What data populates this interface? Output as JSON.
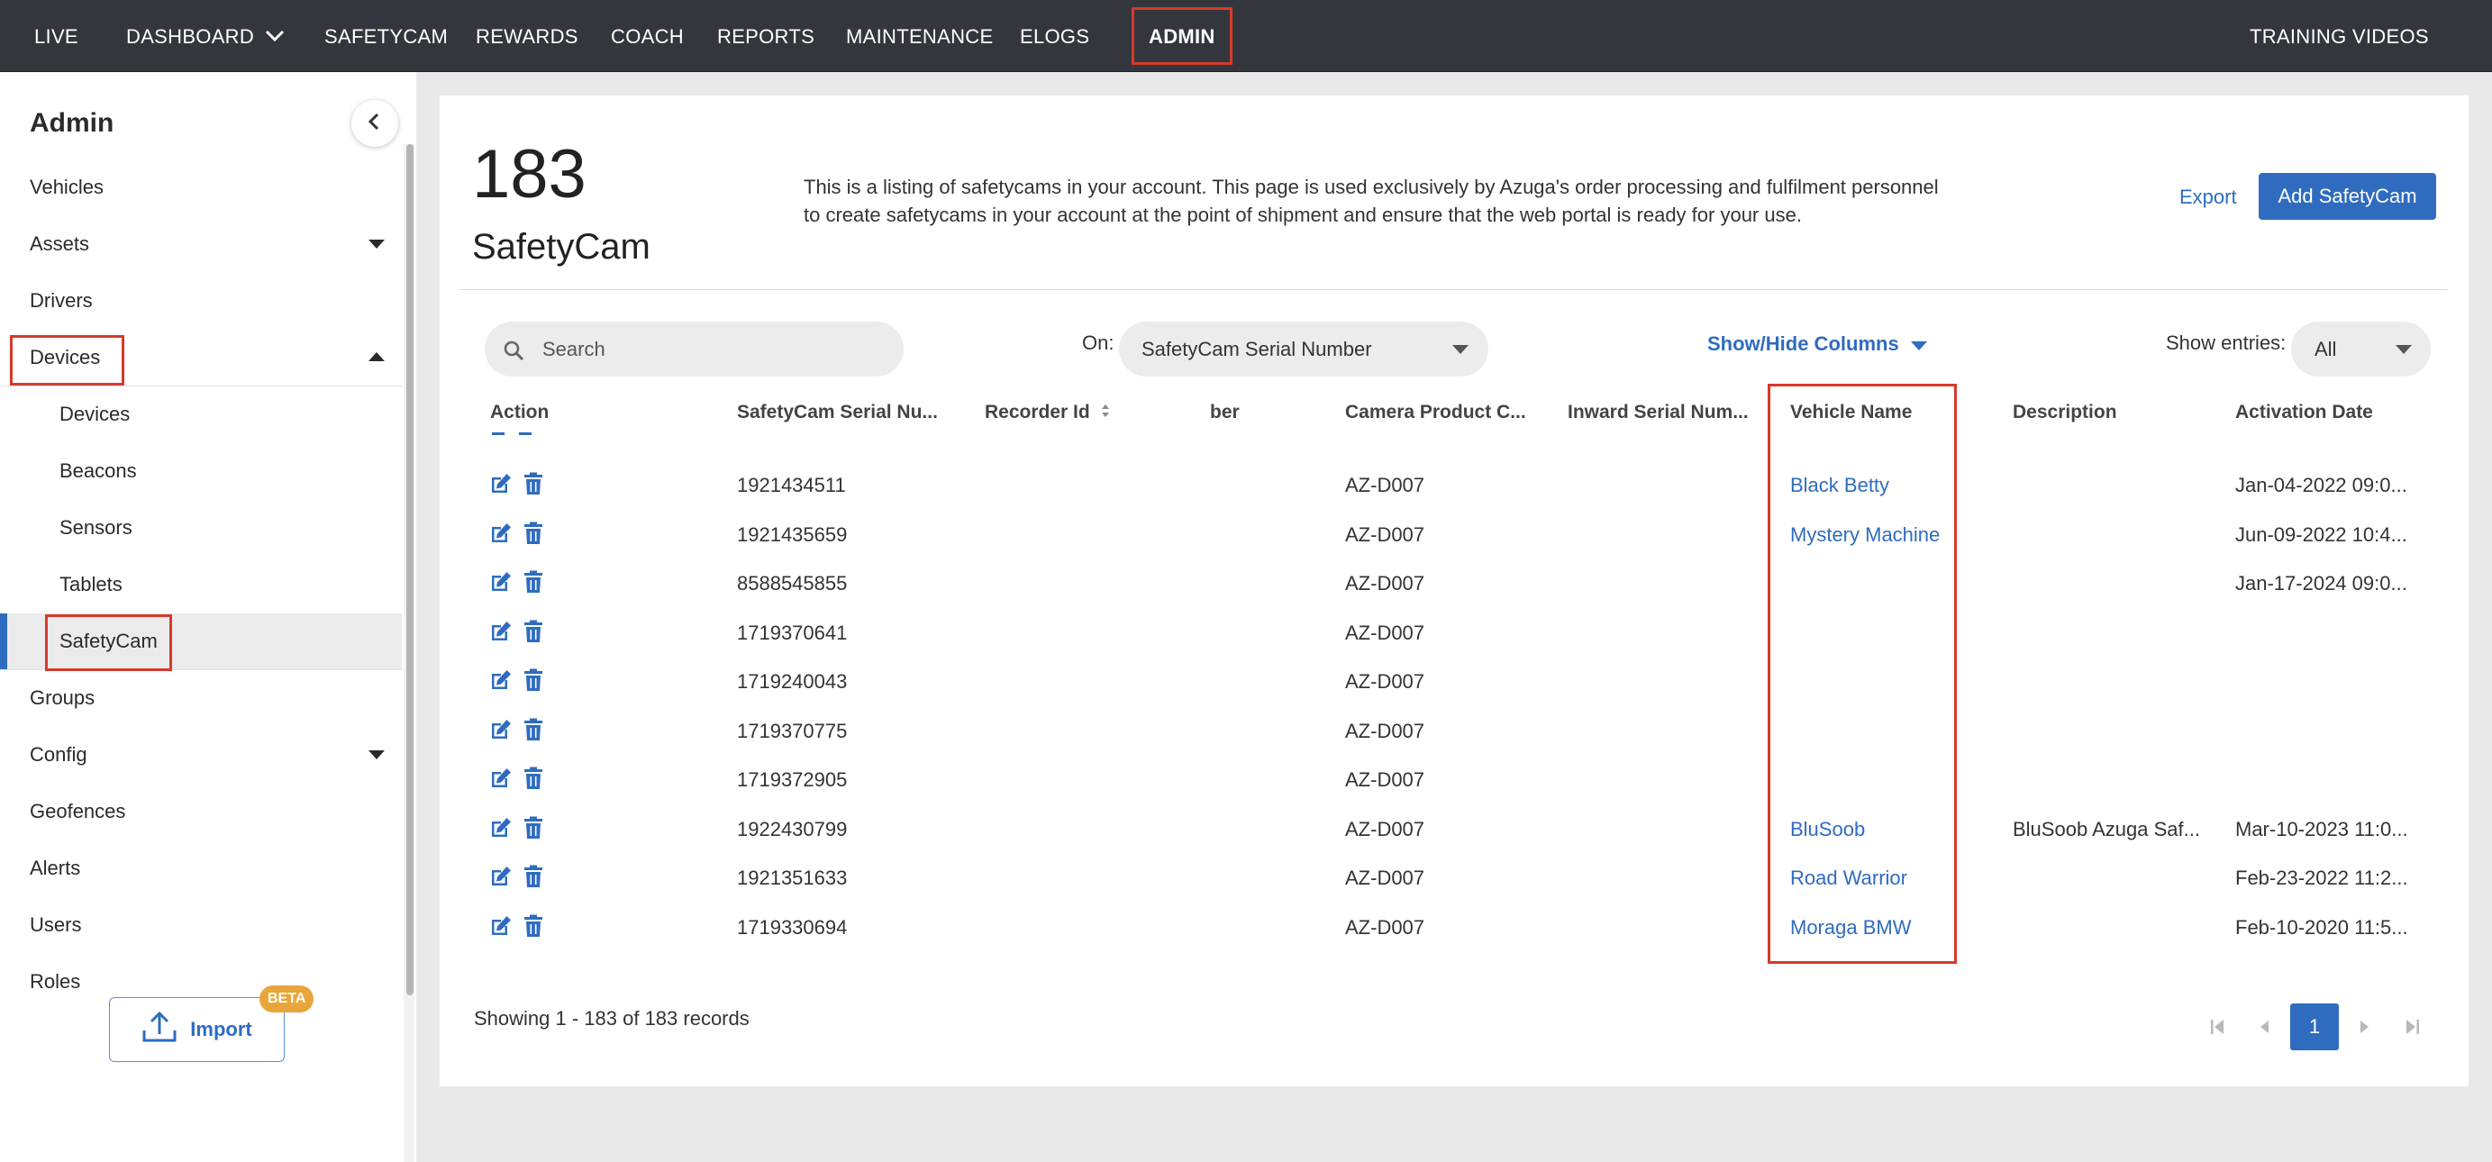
{
  "topnav": {
    "items": [
      {
        "label": "LIVE"
      },
      {
        "label": "DASHBOARD"
      },
      {
        "label": "SAFETYCAM"
      },
      {
        "label": "REWARDS"
      },
      {
        "label": "COACH"
      },
      {
        "label": "REPORTS"
      },
      {
        "label": "MAINTENANCE"
      },
      {
        "label": "ELOGS"
      },
      {
        "label": "ADMIN"
      }
    ],
    "active": "ADMIN",
    "training": "TRAINING VIDEOS"
  },
  "sidebar": {
    "title": "Admin",
    "collapse_icon": "chevron-left-icon",
    "items": [
      {
        "label": "Vehicles"
      },
      {
        "label": "Assets"
      },
      {
        "label": "Drivers"
      },
      {
        "label": "Devices"
      },
      {
        "label": "Devices"
      },
      {
        "label": "Beacons"
      },
      {
        "label": "Sensors"
      },
      {
        "label": "Tablets"
      },
      {
        "label": "SafetyCam"
      },
      {
        "label": "Groups"
      },
      {
        "label": "Config"
      },
      {
        "label": "Geofences"
      },
      {
        "label": "Alerts"
      },
      {
        "label": "Users"
      },
      {
        "label": "Roles"
      }
    ],
    "import_label": "Import",
    "beta_badge": "BETA"
  },
  "header": {
    "count": "183",
    "label": "SafetyCam",
    "description": "This is a listing of safetycams in your account. This page is used exclusively by Azuga's order processing and fulfilment personnel to create safetycams in your account at the point of shipment and ensure that the web portal is ready for your use.",
    "export_label": "Export",
    "add_label": "Add SafetyCam"
  },
  "toolbar": {
    "search_placeholder": "Search",
    "on_label": "On:",
    "on_value": "SafetyCam Serial Number",
    "show_hide_label": "Show/Hide Columns",
    "entries_label": "Show entries:",
    "entries_value": "All"
  },
  "table": {
    "columns": [
      "Action",
      "SafetyCam Serial Nu...",
      "Recorder Id",
      "ber",
      "Camera Product C...",
      "Inward Serial Num...",
      "Vehicle Name",
      "Description",
      "Activation Date"
    ],
    "rows": [
      {
        "serial": "1921434511",
        "product": "AZ-D007",
        "vehicle": "Black Betty",
        "description": "",
        "activation": "Jan-04-2022 09:0..."
      },
      {
        "serial": "1921435659",
        "product": "AZ-D007",
        "vehicle": "Mystery Machine",
        "description": "",
        "activation": "Jun-09-2022 10:4..."
      },
      {
        "serial": "8588545855",
        "product": "AZ-D007",
        "vehicle": "",
        "description": "",
        "activation": "Jan-17-2024 09:0..."
      },
      {
        "serial": "1719370641",
        "product": "AZ-D007",
        "vehicle": "",
        "description": "",
        "activation": ""
      },
      {
        "serial": "1719240043",
        "product": "AZ-D007",
        "vehicle": "",
        "description": "",
        "activation": ""
      },
      {
        "serial": "1719370775",
        "product": "AZ-D007",
        "vehicle": "",
        "description": "",
        "activation": ""
      },
      {
        "serial": "1719372905",
        "product": "AZ-D007",
        "vehicle": "",
        "description": "",
        "activation": ""
      },
      {
        "serial": "1922430799",
        "product": "AZ-D007",
        "vehicle": "BluSoob",
        "description": "BluSoob Azuga Saf...",
        "activation": "Mar-10-2023 11:0..."
      },
      {
        "serial": "1921351633",
        "product": "AZ-D007",
        "vehicle": "Road Warrior",
        "description": "",
        "activation": "Feb-23-2022 11:2..."
      },
      {
        "serial": "1719330694",
        "product": "AZ-D007",
        "vehicle": "Moraga BMW",
        "description": "",
        "activation": "Feb-10-2020 11:5..."
      }
    ],
    "row_icons": [
      "edit-icon",
      "trash-icon"
    ]
  },
  "footer": {
    "showing": "Showing 1 - 183 of 183 records",
    "current_page": "1"
  },
  "colors": {
    "nav_bg": "#33363c",
    "accent": "#2f6cbf",
    "highlight_box": "#d63a2b",
    "beta": "#e9a53a"
  }
}
